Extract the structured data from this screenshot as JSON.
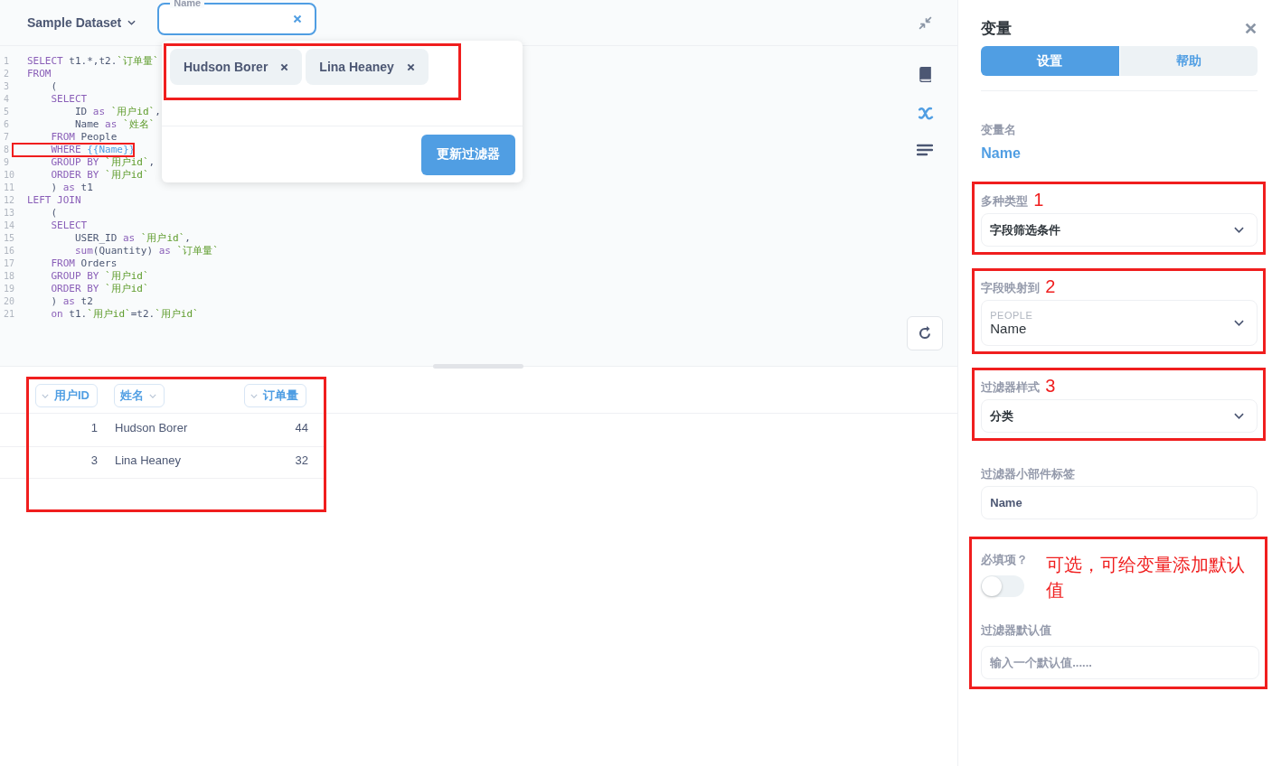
{
  "header": {
    "dataset": "Sample Dataset",
    "filter_widget": {
      "label": "Name"
    }
  },
  "filter_popup": {
    "highlighted": true,
    "chips": [
      {
        "label": "Hudson Borer"
      },
      {
        "label": "Lina Heaney"
      }
    ],
    "update_button": "更新过滤器"
  },
  "editor": {
    "lines": [
      {
        "number": "1",
        "highlighted": false,
        "tokens": [
          {
            "kind": "kw",
            "text": "SELECT"
          },
          {
            "kind": "plain",
            "text": " t1.*,t2."
          },
          {
            "kind": "str",
            "text": "`订单量`"
          }
        ]
      },
      {
        "number": "2",
        "highlighted": false,
        "tokens": [
          {
            "kind": "kw",
            "text": "FROM"
          }
        ]
      },
      {
        "number": "3",
        "highlighted": false,
        "tokens": [
          {
            "kind": "plain",
            "text": "    ("
          }
        ]
      },
      {
        "number": "4",
        "highlighted": false,
        "tokens": [
          {
            "kind": "kw",
            "text": "    SELECT"
          }
        ]
      },
      {
        "number": "5",
        "highlighted": false,
        "tokens": [
          {
            "kind": "plain",
            "text": "        ID "
          },
          {
            "kind": "kw",
            "text": "as"
          },
          {
            "kind": "str",
            "text": " `用户id`"
          },
          {
            "kind": "plain",
            "text": ","
          }
        ]
      },
      {
        "number": "6",
        "highlighted": false,
        "tokens": [
          {
            "kind": "plain",
            "text": "        Name "
          },
          {
            "kind": "kw",
            "text": "as"
          },
          {
            "kind": "str",
            "text": " `姓名`"
          }
        ]
      },
      {
        "number": "7",
        "highlighted": false,
        "tokens": [
          {
            "kind": "kw",
            "text": "    FROM"
          },
          {
            "kind": "plain",
            "text": " People"
          }
        ]
      },
      {
        "number": "8",
        "highlighted": true,
        "tokens": [
          {
            "kind": "kw",
            "text": "    WHERE"
          },
          {
            "kind": "var",
            "text": " {{Name}}"
          }
        ]
      },
      {
        "number": "9",
        "highlighted": false,
        "tokens": [
          {
            "kind": "kw",
            "text": "    GROUP BY"
          },
          {
            "kind": "str",
            "text": " `用户id`"
          },
          {
            "kind": "plain",
            "text": ","
          }
        ]
      },
      {
        "number": "10",
        "highlighted": false,
        "tokens": [
          {
            "kind": "kw",
            "text": "    ORDER BY"
          },
          {
            "kind": "str",
            "text": " `用户id`"
          }
        ]
      },
      {
        "number": "11",
        "highlighted": false,
        "tokens": [
          {
            "kind": "plain",
            "text": "    ) "
          },
          {
            "kind": "kw",
            "text": "as"
          },
          {
            "kind": "plain",
            "text": " t1"
          }
        ]
      },
      {
        "number": "12",
        "highlighted": false,
        "tokens": [
          {
            "kind": "kw",
            "text": "LEFT JOIN"
          }
        ]
      },
      {
        "number": "13",
        "highlighted": false,
        "tokens": [
          {
            "kind": "plain",
            "text": "    ("
          }
        ]
      },
      {
        "number": "14",
        "highlighted": false,
        "tokens": [
          {
            "kind": "kw",
            "text": "    SELECT"
          }
        ]
      },
      {
        "number": "15",
        "highlighted": false,
        "tokens": [
          {
            "kind": "plain",
            "text": "        USER_ID "
          },
          {
            "kind": "kw",
            "text": "as"
          },
          {
            "kind": "str",
            "text": " `用户id`"
          },
          {
            "kind": "plain",
            "text": ","
          }
        ]
      },
      {
        "number": "16",
        "highlighted": false,
        "tokens": [
          {
            "kind": "kw",
            "text": "        sum"
          },
          {
            "kind": "plain",
            "text": "(Quantity) "
          },
          {
            "kind": "kw",
            "text": "as"
          },
          {
            "kind": "str",
            "text": " `订单量`"
          }
        ]
      },
      {
        "number": "17",
        "highlighted": false,
        "tokens": [
          {
            "kind": "kw",
            "text": "    FROM"
          },
          {
            "kind": "plain",
            "text": " Orders"
          }
        ]
      },
      {
        "number": "18",
        "highlighted": false,
        "tokens": [
          {
            "kind": "kw",
            "text": "    GROUP BY"
          },
          {
            "kind": "str",
            "text": " `用户id`"
          }
        ]
      },
      {
        "number": "19",
        "highlighted": false,
        "tokens": [
          {
            "kind": "kw",
            "text": "    ORDER BY"
          },
          {
            "kind": "str",
            "text": " `用户id`"
          }
        ]
      },
      {
        "number": "20",
        "highlighted": false,
        "tokens": [
          {
            "kind": "plain",
            "text": "    ) "
          },
          {
            "kind": "kw",
            "text": "as"
          },
          {
            "kind": "plain",
            "text": " t2"
          }
        ]
      },
      {
        "number": "21",
        "highlighted": false,
        "tokens": [
          {
            "kind": "kw",
            "text": "    on"
          },
          {
            "kind": "plain",
            "text": " t1."
          },
          {
            "kind": "str",
            "text": "`用户id`"
          },
          {
            "kind": "plain",
            "text": "=t2."
          },
          {
            "kind": "str",
            "text": "`用户id`"
          }
        ]
      }
    ]
  },
  "table": {
    "highlighted": true,
    "columns": [
      {
        "label": "用户ID",
        "kind": "number"
      },
      {
        "label": "姓名",
        "kind": "text"
      },
      {
        "label": "订单量",
        "kind": "number"
      }
    ],
    "rows": [
      [
        "1",
        "Hudson Borer",
        "44"
      ],
      [
        "3",
        "Lina Heaney",
        "32"
      ]
    ]
  },
  "sidebar": {
    "title": "变量",
    "tabs": [
      {
        "label": "设置",
        "selected": true
      },
      {
        "label": "帮助",
        "selected": false
      }
    ],
    "variable_name_label": "变量名",
    "variable_name": "Name",
    "fields": [
      {
        "kind": "select",
        "label": "多种类型",
        "value": "字段筛选条件",
        "highlighted": true,
        "annotation": "1"
      },
      {
        "kind": "select",
        "label": "字段映射到",
        "table": "PEOPLE",
        "value": "Name",
        "highlighted": true,
        "annotation": "2"
      },
      {
        "kind": "select",
        "label": "过滤器样式",
        "value": "分类",
        "highlighted": true,
        "annotation": "3"
      },
      {
        "kind": "input",
        "label": "过滤器小部件标签",
        "value": "Name",
        "highlighted": false
      }
    ],
    "optional_section": {
      "highlighted": true,
      "note": "可选，可给变量添加默认值",
      "required_label": "必填项？",
      "required_on": false,
      "default_label": "过滤器默认值",
      "default_placeholder": "输入一个默认值......"
    }
  }
}
